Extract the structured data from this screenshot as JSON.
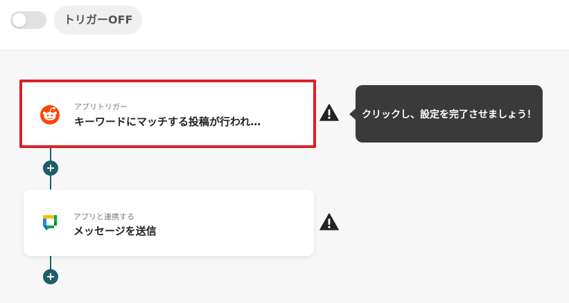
{
  "header": {
    "toggle_state": "off",
    "trigger_status_label": "トリガーOFF"
  },
  "flow": {
    "steps": [
      {
        "kind": "アプリトリガー",
        "title": "キーワードにマッチする投稿が行われ…",
        "app_icon": "reddit-icon",
        "warning_icon": "warning-icon"
      },
      {
        "kind": "アプリと連携する",
        "title": "メッセージを送信",
        "app_icon": "google-chat-icon",
        "warning_icon": "warning-icon"
      }
    ],
    "add_step_icon": "plus-icon"
  },
  "tooltip": {
    "text": "クリックし、設定を完了させましょう！"
  },
  "colors": {
    "connector": "#1f5b6b",
    "highlight_border": "#dc1f26",
    "tooltip_bg": "#3a3a3a",
    "reddit": "#ff4500"
  }
}
